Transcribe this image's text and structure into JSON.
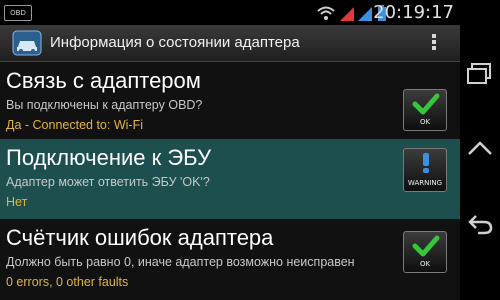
{
  "status_bar": {
    "notification_badge": "OBD",
    "time": "20:19:17",
    "icons": [
      "wifi-icon",
      "signal-icon",
      "signal-icon",
      "battery-icon"
    ]
  },
  "action_bar": {
    "title": "Информация о состоянии адаптера",
    "app_icon": "car-obd-icon",
    "menu_icon": "overflow-menu-icon"
  },
  "items": [
    {
      "title": "Связь с адаптером",
      "description": "Вы подключены к адаптеру OBD?",
      "value": "Да - Connected to: Wi-Fi",
      "status_label": "OK",
      "status_icon": "checkmark-icon"
    },
    {
      "title": "Подключение к ЭБУ",
      "description": "Адаптер может ответить ЭБУ 'OK'?",
      "value": "Нет",
      "status_label": "WARNING",
      "status_icon": "exclamation-icon"
    },
    {
      "title": "Счётчик ошибок адаптера",
      "description": "Должно быть равно 0, иначе адаптер возможно неисправен",
      "value": "0 errors, 0 other faults",
      "status_label": "OK",
      "status_icon": "checkmark-icon"
    }
  ],
  "nav_bar": {
    "icons": [
      "recent-apps-icon",
      "home-icon",
      "back-icon"
    ]
  },
  "colors": {
    "highlight_row": "#1d4f4f",
    "value_text": "#e3b53a",
    "ok_green": "#39c43b",
    "warning_blue": "#3d8fe0"
  }
}
